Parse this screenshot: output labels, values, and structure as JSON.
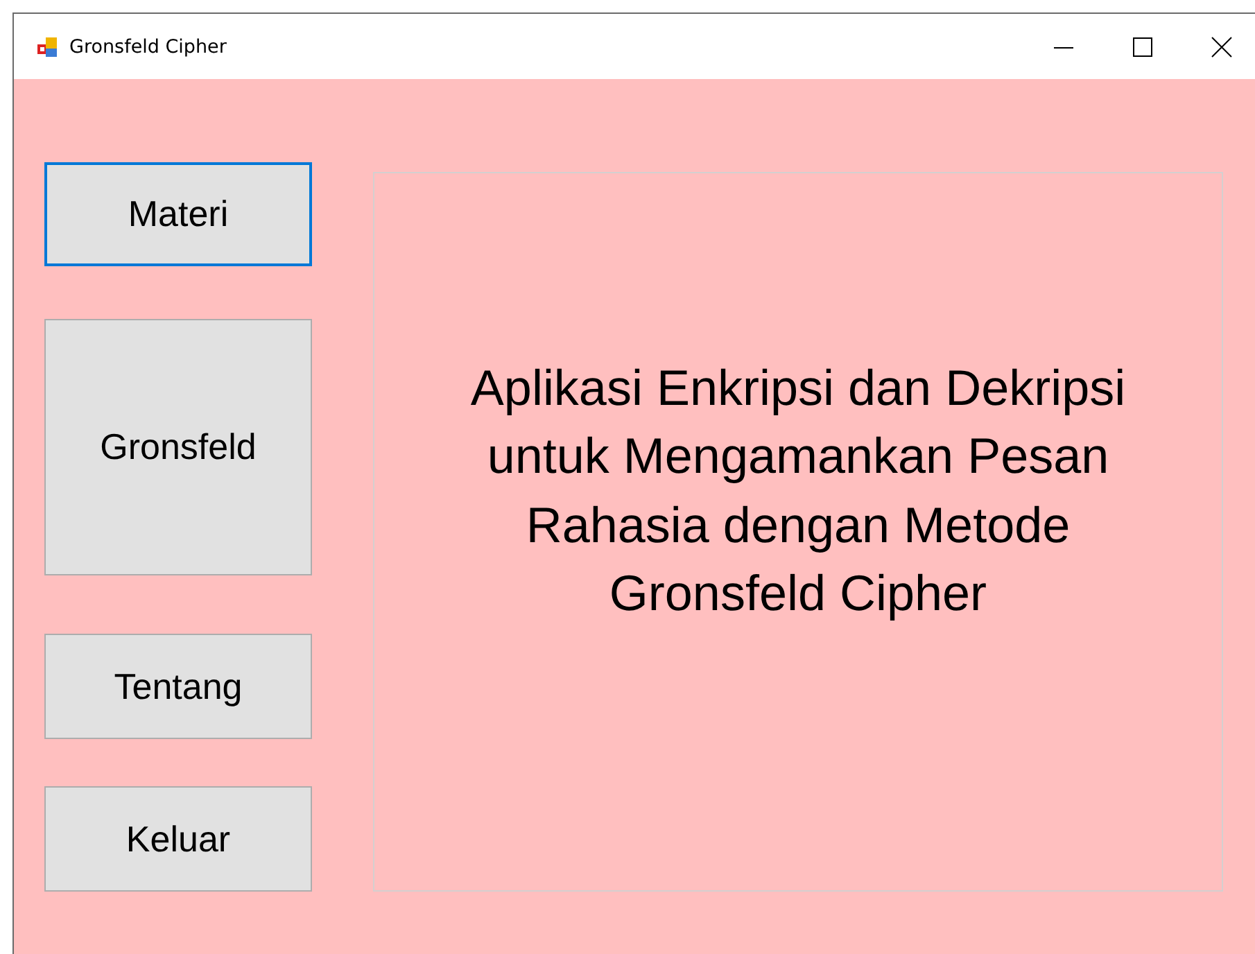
{
  "window": {
    "title": "Gronsfeld Cipher"
  },
  "buttons": [
    {
      "label": "Materi",
      "focused": true
    },
    {
      "label": "Gronsfeld",
      "focused": false
    },
    {
      "label": "Tentang",
      "focused": false
    },
    {
      "label": "Keluar",
      "focused": false
    }
  ],
  "panel": {
    "text": "Aplikasi Enkripsi dan Dekripsi untuk Mengamankan Pesan Rahasia dengan Metode Gronsfeld Cipher"
  }
}
